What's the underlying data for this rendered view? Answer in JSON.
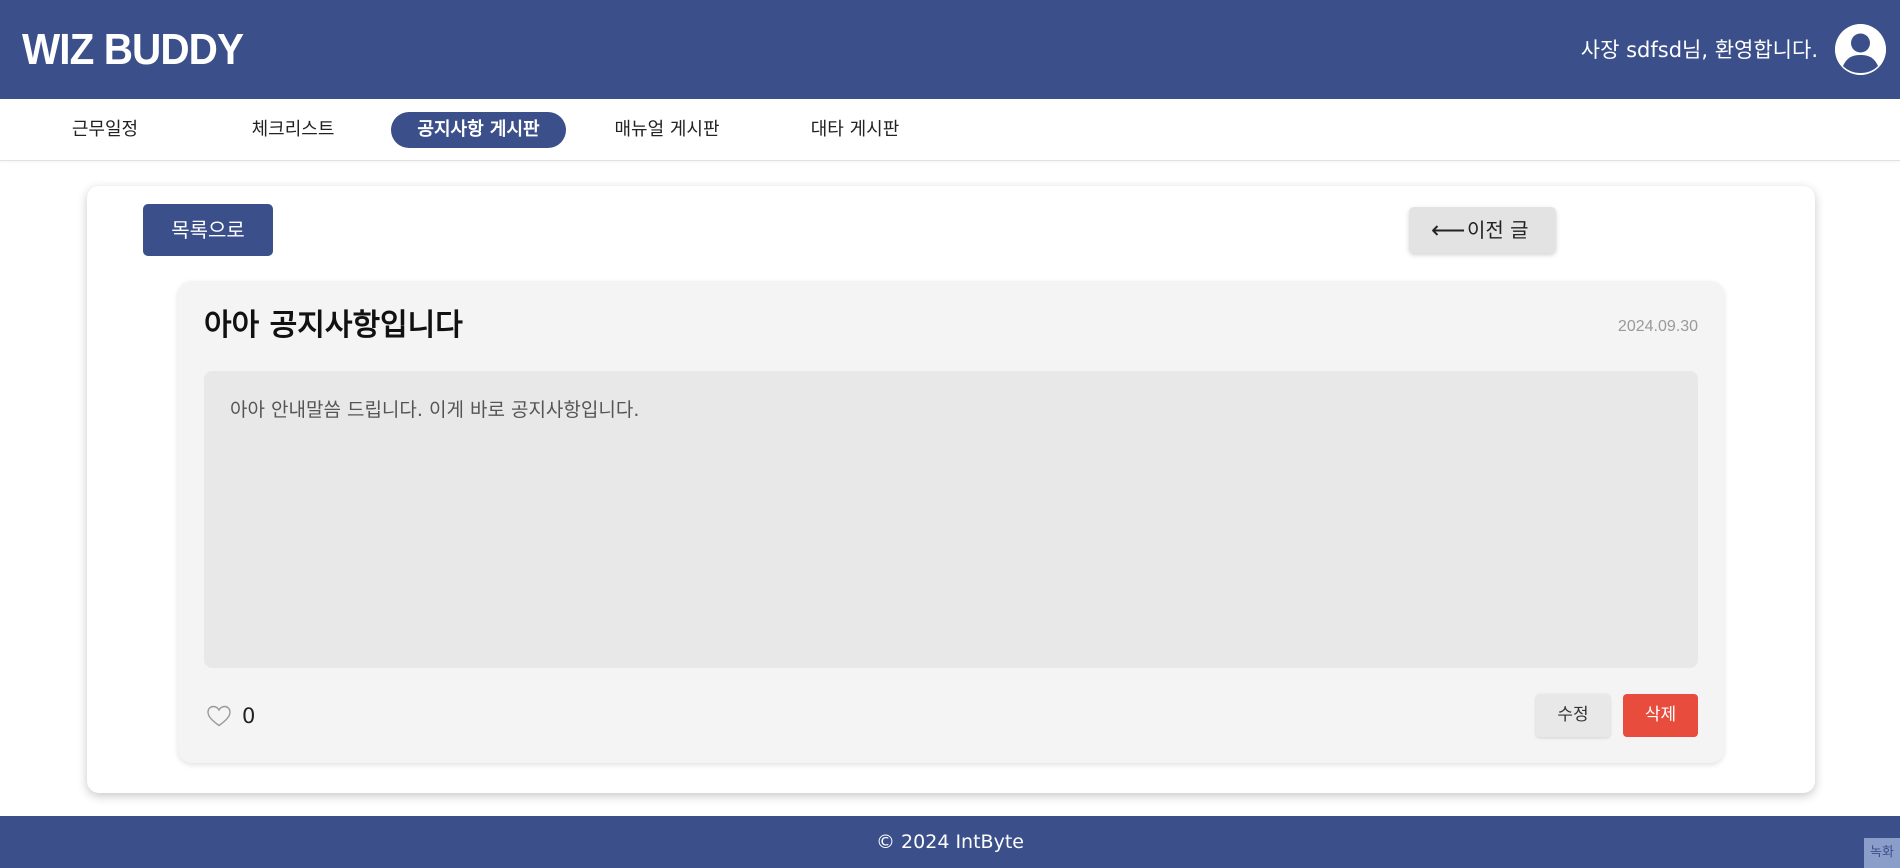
{
  "header": {
    "logo": "WIZ BUDDY",
    "welcome": "사장 sdfsd님, 환영합니다.",
    "avatar_icon": "user-circle-icon",
    "background": "#3b4f8a"
  },
  "nav": {
    "items": [
      {
        "label": "근무일정",
        "active": false
      },
      {
        "label": "체크리스트",
        "active": false
      },
      {
        "label": "공지사항 게시판",
        "active": true
      },
      {
        "label": "매뉴얼 게시판",
        "active": false
      },
      {
        "label": "대타 게시판",
        "active": false
      }
    ]
  },
  "actions": {
    "list_label": "목록으로",
    "prev_arrow": "⟵",
    "prev_label": "이전 글"
  },
  "post": {
    "title": "아아 공지사항입니다",
    "date": "2024.09.30",
    "content": "아아 안내말씀 드립니다. 이게 바로 공지사항입니다.",
    "like_icon": "heart-icon",
    "like_count": "0",
    "edit_label": "수정",
    "delete_label": "삭제"
  },
  "colors": {
    "primary": "#3b4f8a",
    "danger": "#e74c3c"
  },
  "footer": {
    "copyright": "© 2024 IntByte"
  },
  "corner_tab": "녹화"
}
